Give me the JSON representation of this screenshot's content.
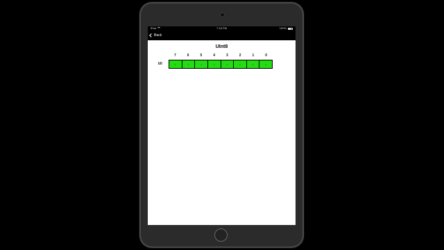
{
  "status_bar": {
    "carrier": "iPad",
    "time": "7:18 PM",
    "battery_text": "100%"
  },
  "nav": {
    "back_label": "Back"
  },
  "main": {
    "title": "UInt8",
    "bit_indices": [
      "7",
      "6",
      "5",
      "4",
      "3",
      "2",
      "1",
      "0"
    ],
    "bytes": [
      {
        "label": "b0",
        "bits": [
          "1",
          "1",
          "1",
          "1",
          "1",
          "1",
          "1",
          "1"
        ]
      }
    ]
  },
  "colors": {
    "background": "#000000",
    "bit_on": "#22dd11",
    "nav_bar": "#000000",
    "screen": "#ffffff"
  },
  "icons": {
    "back": "chevron-left-icon",
    "wifi": "wifi-icon",
    "battery": "battery-icon",
    "camera": "camera-icon",
    "home": "home-button"
  }
}
